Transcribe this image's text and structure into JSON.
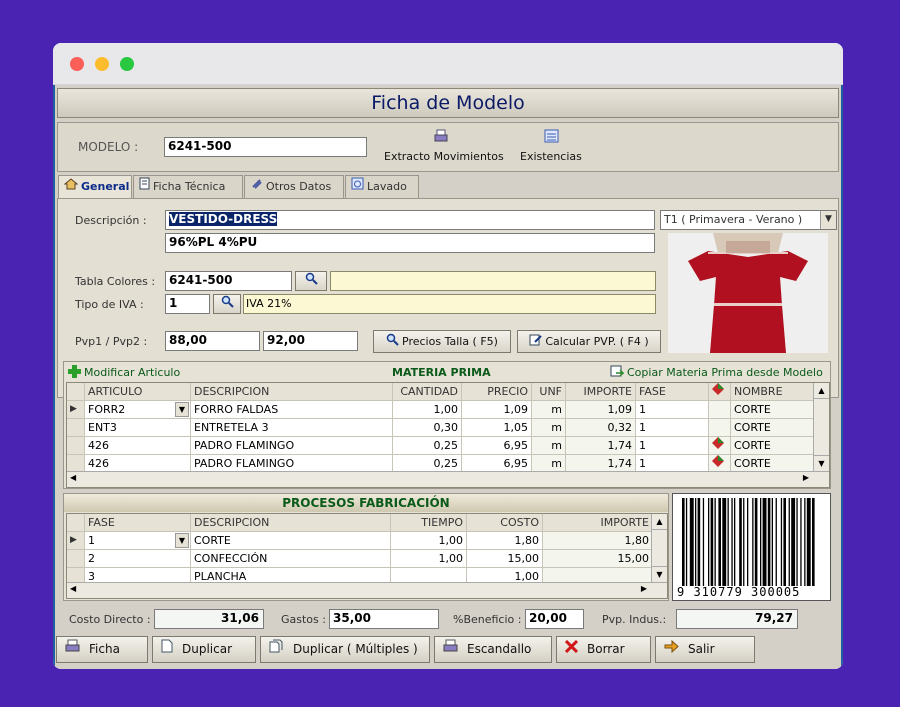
{
  "title": "Ficha de Modelo",
  "modelo": {
    "label": "MODELO  :",
    "value": "6241-500"
  },
  "toolbar": {
    "extracto": "Extracto Movimientos",
    "existencias": "Existencias"
  },
  "tabs": [
    "General",
    "Ficha Técnica",
    "Otros Datos",
    "Lavado"
  ],
  "descripcion": {
    "label": "Descripción :",
    "line1": "VESTIDO-DRESS",
    "line2": "96%PL 4%PU"
  },
  "temporada": "T1 ( Primavera - Verano )",
  "tabla_colores": {
    "label": "Tabla Colores :",
    "value": "6241-500",
    "desc": ""
  },
  "tipo_iva": {
    "label": "Tipo de IVA :",
    "value": "1",
    "desc": "IVA 21%"
  },
  "pvp": {
    "label": "Pvp1 / Pvp2 :",
    "pvp1": "88,00",
    "pvp2": "92,00"
  },
  "buttons": {
    "precios_talla": "Precios Talla ( F5)",
    "calcular_pvp": "Calcular PVP. ( F4 )"
  },
  "materia_prima": {
    "title": "MATERIA PRIMA",
    "modificar": "Modificar Articulo",
    "copiar": "Copiar Materia Prima desde Modelo",
    "headers": [
      "ARTICULO",
      "DESCRIPCION",
      "CANTIDAD",
      "PRECIO",
      "UNF",
      "IMPORTE",
      "FASE",
      "",
      "NOMBRE"
    ],
    "rows": [
      [
        "FORR2",
        "FORRO FALDAS",
        "1,00",
        "1,09",
        "m",
        "1,09",
        "1",
        "",
        "CORTE"
      ],
      [
        "ENT3",
        "ENTRETELA 3",
        "0,30",
        "1,05",
        "m",
        "0,32",
        "1",
        "",
        "CORTE"
      ],
      [
        "426",
        "PADRO FLAMINGO",
        "0,25",
        "6,95",
        "m",
        "1,74",
        "1",
        "diamond",
        "CORTE"
      ],
      [
        "426",
        "PADRO FLAMINGO",
        "0,25",
        "6,95",
        "m",
        "1,74",
        "1",
        "diamond",
        "CORTE"
      ]
    ]
  },
  "procesos": {
    "title": "PROCESOS FABRICACIÓN",
    "headers": [
      "FASE",
      "DESCRIPCION",
      "TIEMPO",
      "COSTO",
      "IMPORTE"
    ],
    "rows": [
      [
        "1",
        "CORTE",
        "1,00",
        "1,80",
        "1,80"
      ],
      [
        "2",
        "CONFECCIÓN",
        "1,00",
        "15,00",
        "15,00"
      ],
      [
        "3",
        "PLANCHA",
        "",
        "1,00",
        ""
      ]
    ]
  },
  "barcode": "9 310779 300005",
  "totals": {
    "costo_label": "Costo Directo :",
    "costo": "31,06",
    "gastos_label": "Gastos :",
    "gastos": "35,00",
    "beneficio_label": "%Beneficio :",
    "beneficio": "20,00",
    "pvp_label": "Pvp. Indus.:",
    "pvp": "79,27"
  },
  "bottom": [
    "Ficha",
    "Duplicar",
    "Duplicar ( Múltiples )",
    "Escandallo",
    "Borrar",
    "Salir"
  ],
  "colors": {
    "background": "#4a23b3",
    "title_text": "#0a1a66",
    "header_green": "#0a5a1a"
  }
}
